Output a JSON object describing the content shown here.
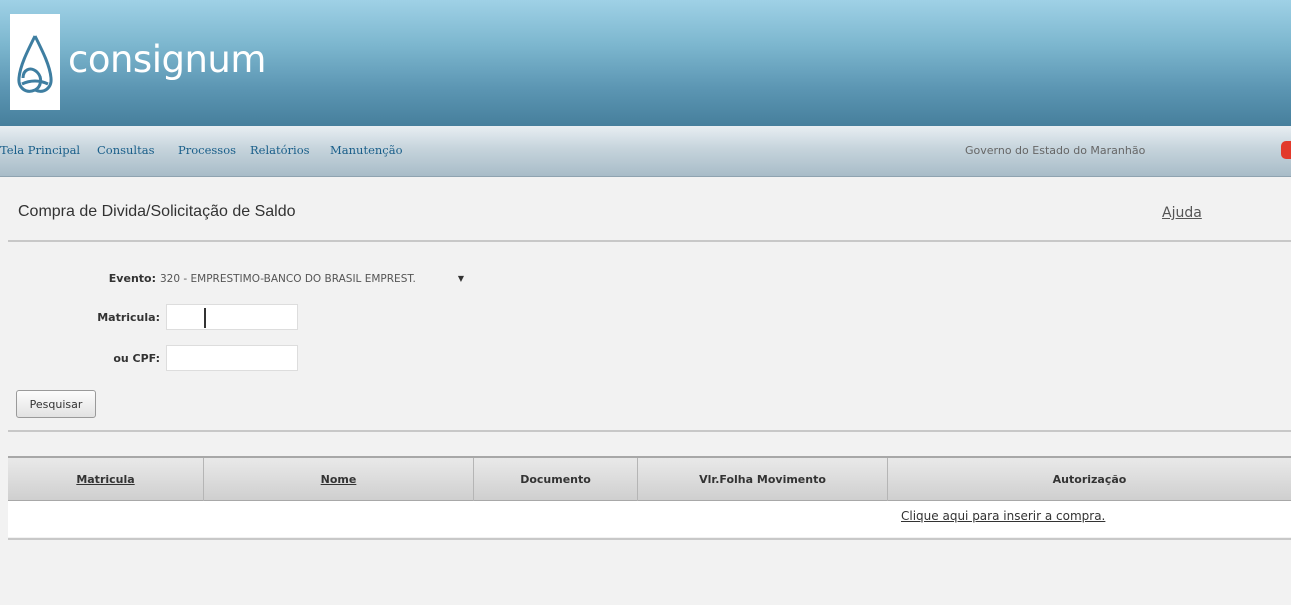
{
  "app": {
    "logo_text": "consignum"
  },
  "nav": {
    "items": [
      "Tela Principal",
      "Consultas",
      "Processos",
      "Relatórios",
      "Manutenção"
    ],
    "org": "Governo do Estado do Maranhão"
  },
  "page": {
    "title": "Compra de Divida/Solicitação de Saldo",
    "help": "Ajuda"
  },
  "form": {
    "evento_label": "Evento:",
    "evento_value": "320 - EMPRESTIMO-BANCO DO BRASIL EMPREST.",
    "matricula_label": "Matricula:",
    "matricula_value": "",
    "cpf_label": "ou CPF:",
    "cpf_value": "",
    "search_button": "Pesquisar"
  },
  "table": {
    "columns": [
      "Matricula",
      "Nome",
      "Documento",
      "Vlr.Folha Movimento",
      "Autorização"
    ],
    "empty_link": "Clique aqui para inserir a compra."
  },
  "colors": {
    "header_blue": "#5c96b3",
    "nav_link": "#1a5f8a",
    "alert_red": "#e23a2c"
  }
}
